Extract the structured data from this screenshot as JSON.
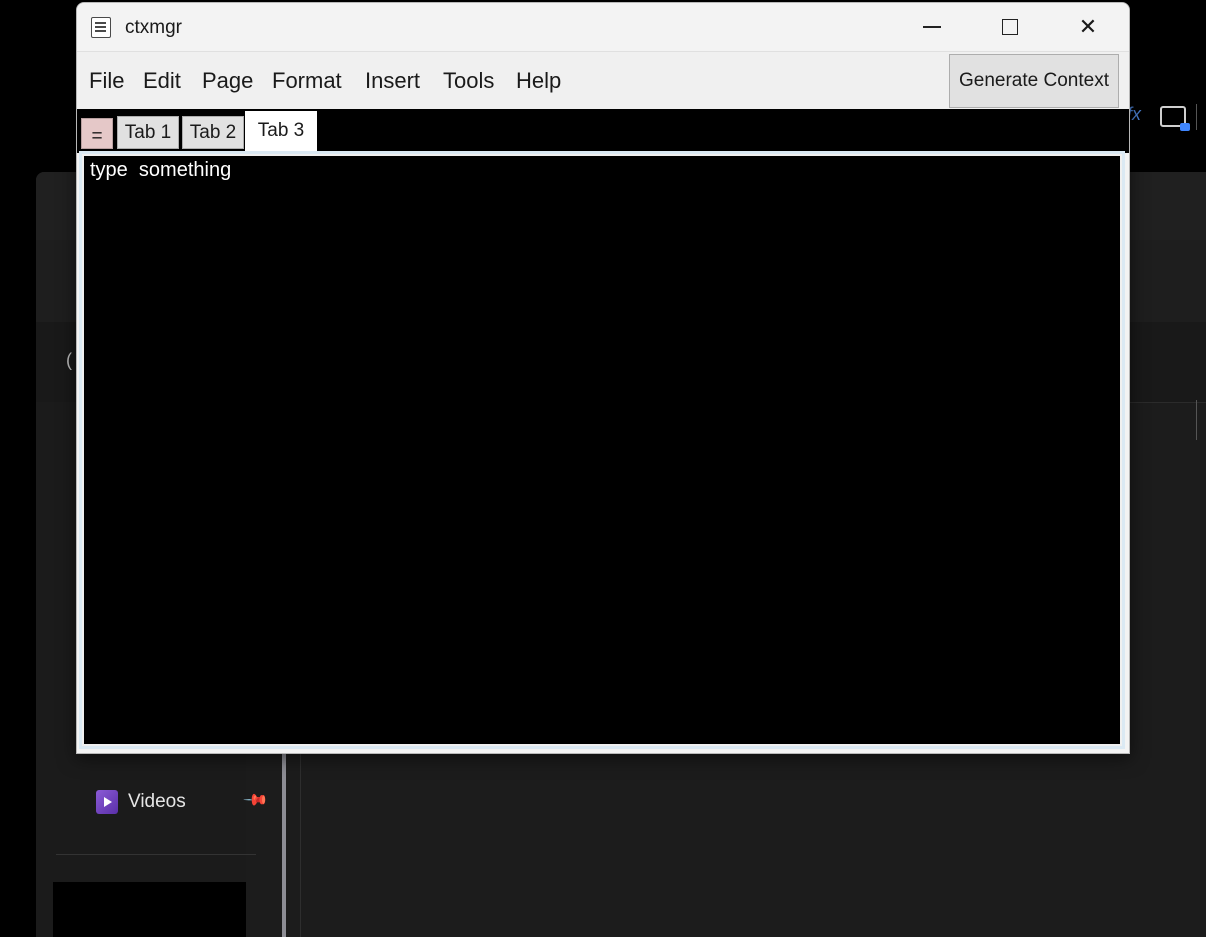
{
  "window": {
    "title": "ctxmgr",
    "controls": {
      "minimize": "minimize",
      "maximize": "maximize",
      "close": "close"
    }
  },
  "menu": {
    "items": [
      "File",
      "Edit",
      "Page",
      "Format",
      "Insert",
      "Tools",
      "Help"
    ],
    "generate_context_label": "Generate Context"
  },
  "tabs": {
    "menu_button_label": "=",
    "items": [
      "Tab 1",
      "Tab 2",
      "Tab 3"
    ],
    "active": "Tab 3"
  },
  "editor": {
    "content": "type  something"
  },
  "background_explorer": {
    "sidebar_items": [
      {
        "label": "Videos",
        "icon": "videos-folder-icon",
        "pinned": true
      }
    ],
    "toolbar_icons": [
      "fx-icon",
      "device-icon"
    ]
  }
}
